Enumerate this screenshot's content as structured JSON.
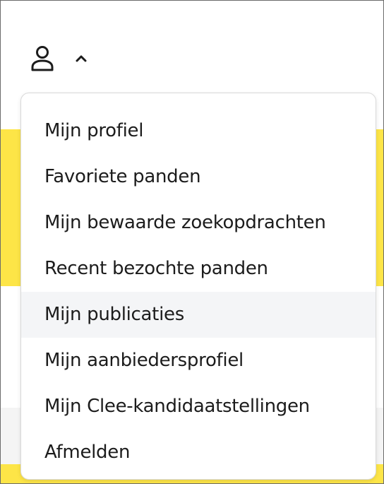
{
  "header": {
    "account_icon": "user-icon",
    "toggle_icon": "chevron-up-icon"
  },
  "account_menu": {
    "items": [
      {
        "label": "Mijn profiel"
      },
      {
        "label": "Favoriete panden"
      },
      {
        "label": "Mijn bewaarde zoekopdrachten"
      },
      {
        "label": "Recent bezochte panden"
      },
      {
        "label": "Mijn publicaties"
      },
      {
        "label": "Mijn aanbiedersprofiel"
      },
      {
        "label": "Mijn Clee-kandidaatstellingen"
      },
      {
        "label": "Afmelden"
      }
    ]
  },
  "colors": {
    "accent_yellow": "#fde547",
    "text": "#1c1c1c",
    "hover_background": "#f4f5f7",
    "menu_border": "#d9d9d9"
  }
}
